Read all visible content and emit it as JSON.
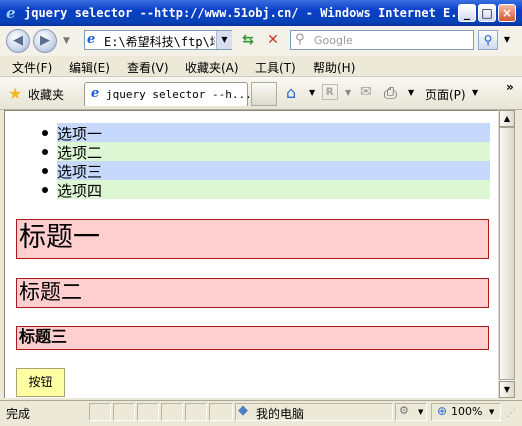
{
  "window": {
    "title": "jquery selector --http://www.51obj.cn/ - Windows Internet E...",
    "min_label": "_",
    "max_label": "□",
    "close_label": "×"
  },
  "toolbar": {
    "address": "E:\\希望科技\\ftp\\培",
    "search_placeholder": "Google"
  },
  "menu": [
    "文件(F)",
    "编辑(E)",
    "查看(V)",
    "收藏夹(A)",
    "工具(T)",
    "帮助(H)"
  ],
  "favorites_bar": {
    "favorites_label": "收藏夹",
    "tab_title": "jquery selector --h...",
    "page_menu": "页面(P)"
  },
  "content": {
    "list_items": [
      "选项一",
      "选项二",
      "选项三",
      "选项四"
    ],
    "h1": "标题一",
    "h2": "标题二",
    "h3": "标题三",
    "button_label": "按钮"
  },
  "status": {
    "text": "完成",
    "zone": "我的电脑",
    "zoom": "100%"
  },
  "colors": {
    "list_blue": "#c6d9fd",
    "list_green": "#ddf6d4",
    "heading_bg": "#ffcfcf",
    "heading_border": "#b01818",
    "button_bg": "#ffffa4"
  },
  "icons": [
    "ie-icon",
    "back-arrow-icon",
    "forward-arrow-icon",
    "refresh-icon",
    "stop-icon",
    "search-icon",
    "star-icon",
    "home-icon",
    "feeds-icon",
    "mail-icon",
    "print-icon",
    "computer-icon",
    "lock-icon",
    "zoom-icon"
  ]
}
